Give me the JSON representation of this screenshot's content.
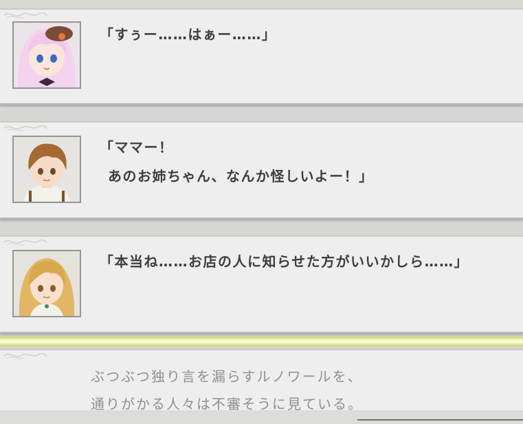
{
  "dialogue": [
    {
      "speaker_icon": "pink-haired-girl-portrait",
      "lines": [
        "「すぅー……はぁー……」"
      ]
    },
    {
      "speaker_icon": "brown-haired-boy-portrait",
      "lines": [
        "「ママー！",
        "あのお姉ちゃん、なんか怪しいよー！」"
      ]
    },
    {
      "speaker_icon": "blonde-woman-portrait",
      "lines": [
        "「本当ね……お店の人に知らせた方がいいかしら……」"
      ]
    }
  ],
  "narration": {
    "lines": [
      "ぶつぶつ独り言を漏らすルノワールを、",
      "通りがかる人々は不審そうに見ている。"
    ]
  },
  "colors": {
    "card": "#eeeeee",
    "text": "#3d3d3d",
    "narration_text": "#8f8f8f",
    "separator": "#eef7b4"
  }
}
